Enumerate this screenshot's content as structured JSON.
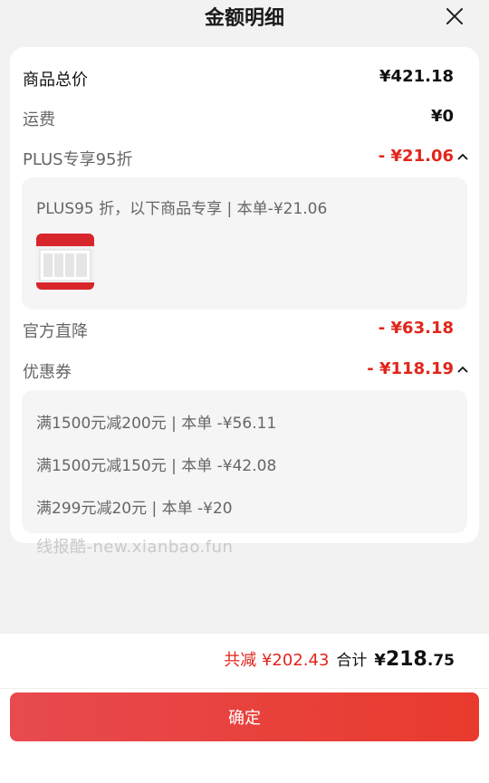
{
  "header": {
    "title": "金额明细",
    "close_icon": "close-icon"
  },
  "rows": {
    "goods_total": {
      "label": "商品总价",
      "value": "¥421.18"
    },
    "shipping": {
      "label": "运费",
      "value": "¥0"
    },
    "plus": {
      "label": "PLUS专享95折",
      "value": "- ¥21.06"
    },
    "official": {
      "label": "官方直降",
      "value": "- ¥63.18"
    },
    "coupon": {
      "label": "优惠券",
      "value": "- ¥118.19"
    }
  },
  "plus_detail": {
    "text": "PLUS95 折，以下商品专享 | 本单-¥21.06"
  },
  "coupons": [
    {
      "text": "满1500元减200元 | 本单 -¥56.11"
    },
    {
      "text": "满1500元减150元 | 本单 -¥42.08"
    },
    {
      "text": "满299元减20元 | 本单 -¥20"
    }
  ],
  "watermark": "线报酷-new.xianbao.fun",
  "summary": {
    "saved": "共减 ¥202.43",
    "total_label": "合计",
    "total_symbol": "¥",
    "total_int": "218",
    "total_dec": ".75"
  },
  "confirm_label": "确定",
  "colors": {
    "accent": "#e1251b",
    "button": "#e93a2d"
  }
}
